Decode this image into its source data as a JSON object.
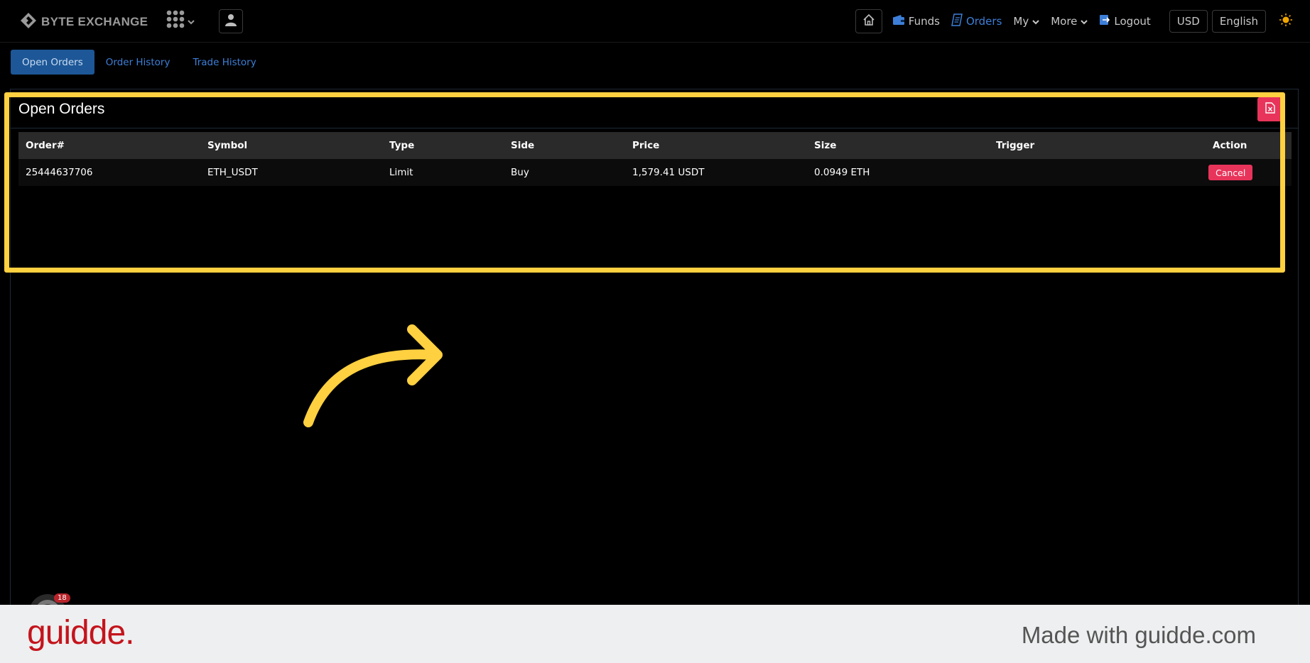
{
  "navbar": {
    "brand": "BYTE EXCHANGE",
    "links": {
      "funds": "Funds",
      "orders": "Orders",
      "my": "My",
      "more": "More",
      "logout": "Logout"
    },
    "currency": "USD",
    "language": "English"
  },
  "tabs": {
    "open_orders": "Open Orders",
    "order_history": "Order History",
    "trade_history": "Trade History"
  },
  "panel": {
    "title": "Open Orders",
    "columns": [
      "Order#",
      "Symbol",
      "Type",
      "Side",
      "Price",
      "Size",
      "Trigger",
      "Action"
    ],
    "rows": [
      {
        "order_id": "25444637706",
        "symbol": "ETH_USDT",
        "type": "Limit",
        "side": "Buy",
        "price": "1,579.41 USDT",
        "size": "0.0949 ETH",
        "trigger": "",
        "action": "Cancel"
      }
    ]
  },
  "chat_badge": "18",
  "footer": {
    "logo": "guidde.",
    "made_with": "Made with guidde.com"
  },
  "colors": {
    "accent_blue": "#3d7fd8",
    "active_tab": "#1d5797",
    "danger": "#e8345a",
    "highlight": "#ffd040",
    "guidde_red": "#c4141c"
  }
}
